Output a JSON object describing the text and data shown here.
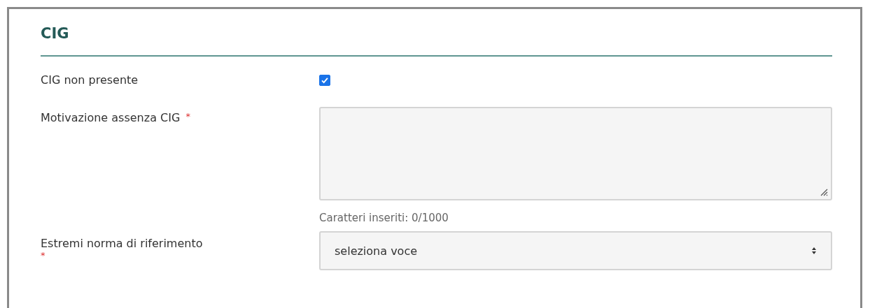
{
  "section": {
    "title": "CIG"
  },
  "fields": [
    {
      "kind": "checkbox",
      "label": "CIG non presente",
      "checked": true
    },
    {
      "kind": "textarea",
      "label": "Motivazione assenza CIG",
      "required_mark": "*",
      "helper": "Caratteri inseriti: 0/1000"
    },
    {
      "kind": "select",
      "label": "Estremi norma di riferimento",
      "required_mark": "*",
      "placeholder": "seleziona voce"
    }
  ]
}
